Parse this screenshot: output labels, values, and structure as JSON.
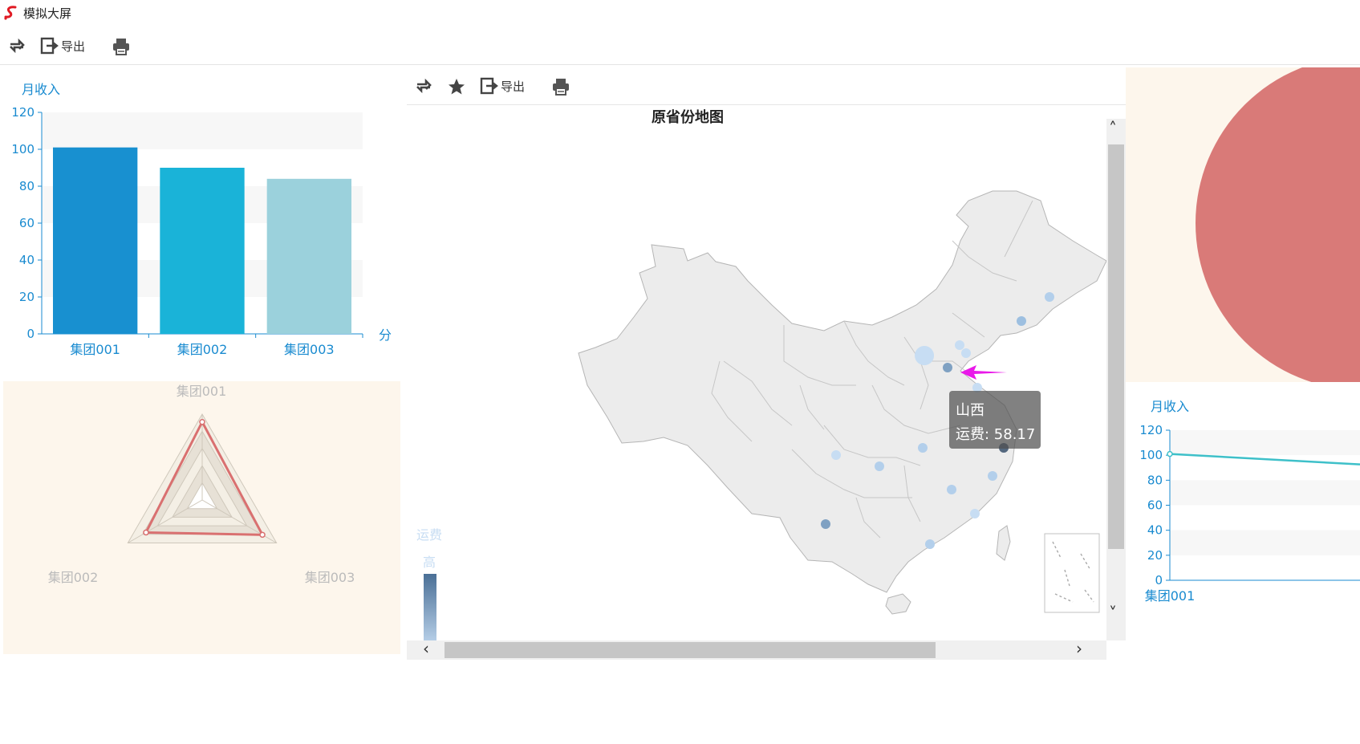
{
  "app": {
    "title": "模拟大屏"
  },
  "toolbar": {
    "export_label": "导出"
  },
  "bar_chart": {
    "chart_data": {
      "type": "bar",
      "title": "月收入",
      "categories": [
        "集团001",
        "集团002",
        "集团003"
      ],
      "values": [
        101,
        90,
        84
      ],
      "colors": [
        "#1890d0",
        "#1ab3d8",
        "#9bd1dc"
      ],
      "ylim": [
        0,
        120
      ],
      "yticks": [
        "0",
        "20",
        "40",
        "60",
        "80",
        "100",
        "120"
      ],
      "xlabel": "分",
      "grid": true
    }
  },
  "radar_chart": {
    "chart_data": {
      "type": "radar",
      "indicators": [
        "集团001",
        "集团002",
        "集团003"
      ],
      "values": [
        101,
        90,
        84
      ],
      "max": 120,
      "color": "#d97070"
    }
  },
  "map_panel": {
    "title": "原省份地图",
    "export_label": "导出",
    "visualmap": {
      "label": "运费",
      "high_label": "高"
    },
    "tooltip": {
      "name": "山西",
      "value_label": "运费: 58.17"
    }
  },
  "line_chart": {
    "chart_data": {
      "type": "line",
      "title": "月收入",
      "categories": [
        "集团001"
      ],
      "values": [
        101
      ],
      "ylim": [
        0,
        120
      ],
      "yticks": [
        "0",
        "20",
        "40",
        "60",
        "80",
        "100",
        "120"
      ],
      "color": "#3ec0c9"
    }
  }
}
